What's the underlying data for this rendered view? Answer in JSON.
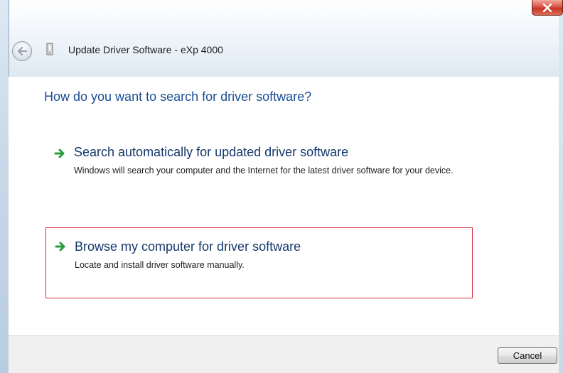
{
  "window": {
    "title": "Update Driver Software - eXp 4000",
    "close_icon": "close-icon",
    "back_icon": "back-arrow-icon",
    "app_icon": "device-icon"
  },
  "content": {
    "heading": "How do you want to search for driver software?",
    "options": [
      {
        "icon": "green-arrow-icon",
        "title": "Search automatically for updated driver software",
        "description": "Windows will search your computer and the Internet for the latest driver software for your device."
      },
      {
        "icon": "green-arrow-icon",
        "title": "Browse my computer for driver software",
        "description": "Locate and install driver software manually."
      }
    ]
  },
  "footer": {
    "cancel_label": "Cancel"
  },
  "colors": {
    "heading": "#1b4e93",
    "option_title": "#15386b",
    "highlight_border": "#d6323a",
    "arrow_green": "#2a9c3a"
  }
}
